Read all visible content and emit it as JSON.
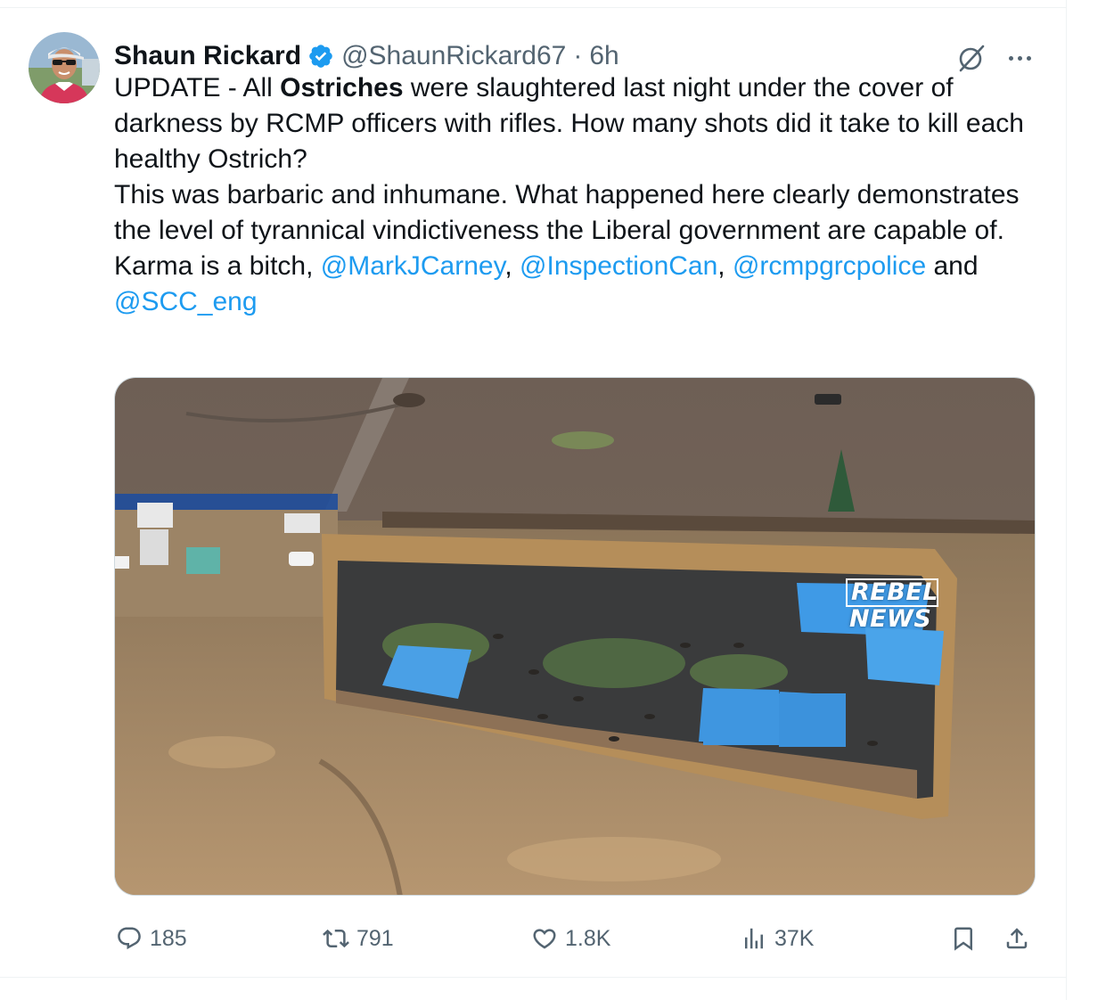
{
  "tweet": {
    "author": {
      "name": "Shaun Rickard",
      "handle": "@ShaunRickard67",
      "separator": "·",
      "time": "6h",
      "verified": true
    },
    "text": {
      "line1_before": "UPDATE - All ",
      "line1_bold": "Ostriches",
      "line1_after": " were slaughtered last night under the cover of darkness by RCMP officers with rifles. How many shots did it take to kill each healthy Ostrich?",
      "line2": "This was barbaric and inhumane. What happened here clearly demonstrates the level of tyrannical vindictiveness the Liberal government are capable of.",
      "line3_before": "Karma is a bitch, ",
      "mention1": "@MarkJCarney",
      "sep1": ", ",
      "mention2": "@InspectionCan",
      "sep2": ", ",
      "mention3": "@rcmpgrcpolice",
      "and": " and ",
      "mention4": "@SCC_eng"
    },
    "media": {
      "watermark_line1": "REBEL",
      "watermark_line2": "NEWS"
    },
    "actions": {
      "replies": "185",
      "reposts": "791",
      "likes": "1.8K",
      "views": "37K"
    }
  },
  "colors": {
    "link": "#1d9bf0",
    "secondary_text": "#536471",
    "verified_badge": "#1d9bf0",
    "border": "#eff3f4"
  },
  "icons": [
    "grok-icon",
    "more-icon",
    "reply-icon",
    "repost-icon",
    "like-icon",
    "views-icon",
    "bookmark-icon",
    "share-icon",
    "verified-badge-icon"
  ]
}
